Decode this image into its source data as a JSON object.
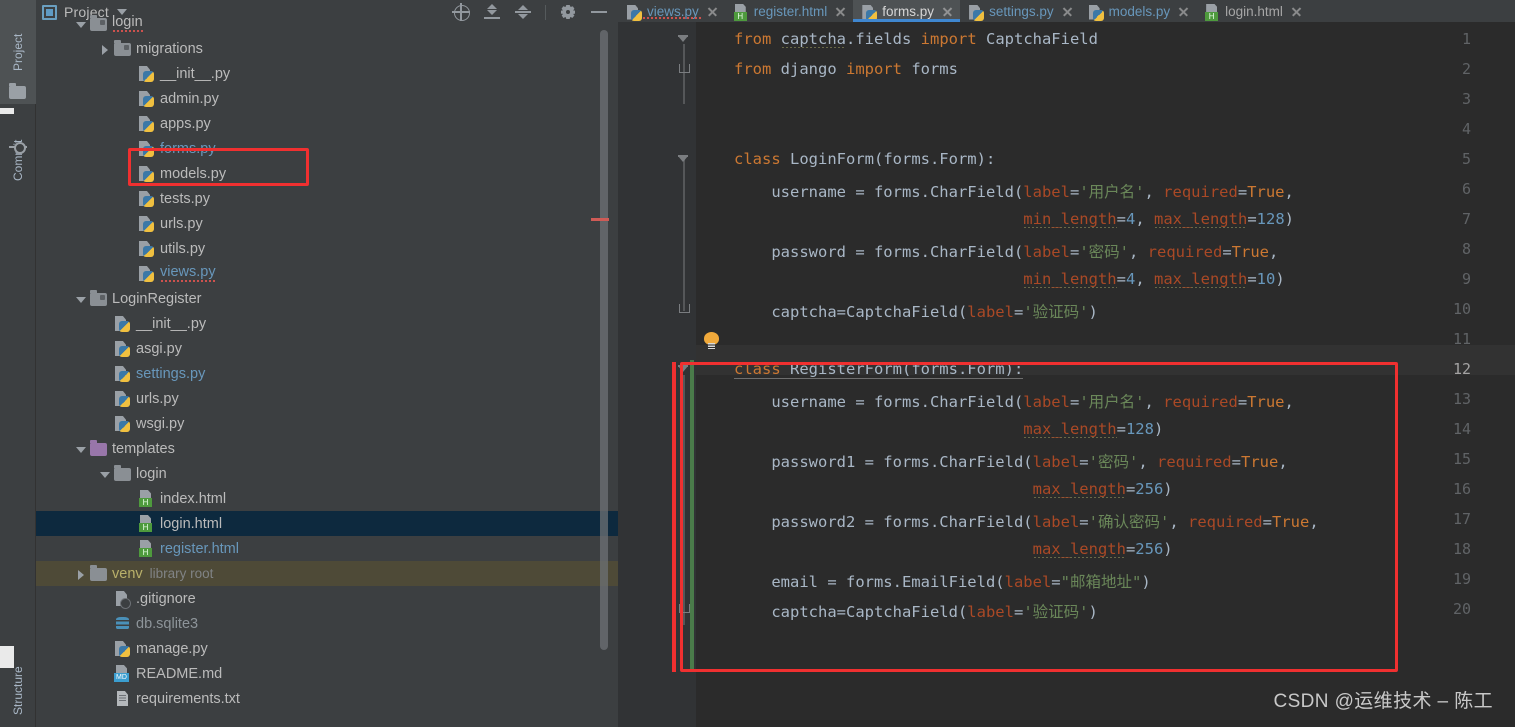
{
  "toolwindows": {
    "left_tabs": [
      {
        "label": "Project",
        "icon": "folder-icon",
        "active": true
      },
      {
        "label": "Commit",
        "icon": "commit-icon",
        "active": false
      },
      {
        "label": "Structure",
        "icon": "structure-icon",
        "active": false
      }
    ]
  },
  "project_panel": {
    "title": "Project",
    "title_icon": "project-view-icon",
    "dropdown_icon": "chevron-down-icon",
    "toolbar": [
      {
        "name": "select-opened-file-icon",
        "tooltip": "Select Opened File"
      },
      {
        "name": "expand-all-icon",
        "tooltip": "Expand All"
      },
      {
        "name": "collapse-all-icon",
        "tooltip": "Collapse All"
      },
      {
        "name": "settings-gear-icon",
        "tooltip": "Options"
      },
      {
        "name": "hide-icon",
        "tooltip": "Hide"
      }
    ],
    "tree": [
      {
        "label": "login",
        "indent": 1,
        "type": "module-folder",
        "arrow": "down",
        "style": "normal",
        "squiggle": true
      },
      {
        "label": "migrations",
        "indent": 2,
        "type": "module-folder",
        "arrow": "right",
        "style": "normal"
      },
      {
        "label": "__init__.py",
        "indent": 3,
        "type": "python",
        "arrow": "none",
        "style": "normal"
      },
      {
        "label": "admin.py",
        "indent": 3,
        "type": "python",
        "arrow": "none",
        "style": "normal"
      },
      {
        "label": "apps.py",
        "indent": 3,
        "type": "python",
        "arrow": "none",
        "style": "normal"
      },
      {
        "label": "forms.py",
        "indent": 3,
        "type": "python",
        "arrow": "none",
        "style": "blue",
        "annotated": true
      },
      {
        "label": "models.py",
        "indent": 3,
        "type": "python",
        "arrow": "none",
        "style": "normal"
      },
      {
        "label": "tests.py",
        "indent": 3,
        "type": "python",
        "arrow": "none",
        "style": "normal"
      },
      {
        "label": "urls.py",
        "indent": 3,
        "type": "python",
        "arrow": "none",
        "style": "normal"
      },
      {
        "label": "utils.py",
        "indent": 3,
        "type": "python",
        "arrow": "none",
        "style": "normal"
      },
      {
        "label": "views.py",
        "indent": 3,
        "type": "python",
        "arrow": "none",
        "style": "blue",
        "squiggle": true
      },
      {
        "label": "LoginRegister",
        "indent": 1,
        "type": "module-folder",
        "arrow": "down",
        "style": "normal"
      },
      {
        "label": "__init__.py",
        "indent": 2,
        "type": "python",
        "arrow": "none",
        "style": "normal"
      },
      {
        "label": "asgi.py",
        "indent": 2,
        "type": "python",
        "arrow": "none",
        "style": "normal"
      },
      {
        "label": "settings.py",
        "indent": 2,
        "type": "python",
        "arrow": "none",
        "style": "blue"
      },
      {
        "label": "urls.py",
        "indent": 2,
        "type": "python",
        "arrow": "none",
        "style": "normal"
      },
      {
        "label": "wsgi.py",
        "indent": 2,
        "type": "python",
        "arrow": "none",
        "style": "normal"
      },
      {
        "label": "templates",
        "indent": 1,
        "type": "template-folder",
        "arrow": "down",
        "style": "normal"
      },
      {
        "label": "login",
        "indent": 2,
        "type": "plain-folder",
        "arrow": "down",
        "style": "normal"
      },
      {
        "label": "index.html",
        "indent": 3,
        "type": "html",
        "arrow": "none",
        "style": "normal"
      },
      {
        "label": "login.html",
        "indent": 3,
        "type": "html",
        "arrow": "none",
        "style": "normal",
        "selected": true
      },
      {
        "label": "register.html",
        "indent": 3,
        "type": "html",
        "arrow": "none",
        "style": "blue"
      },
      {
        "label": "venv",
        "indent": 1,
        "type": "plain-folder",
        "arrow": "right",
        "style": "venv",
        "suffix": "library root"
      },
      {
        "label": ".gitignore",
        "indent": 2,
        "type": "gitignore",
        "arrow": "none",
        "style": "normal"
      },
      {
        "label": "db.sqlite3",
        "indent": 2,
        "type": "sqlite",
        "arrow": "none",
        "style": "dim"
      },
      {
        "label": "manage.py",
        "indent": 2,
        "type": "python",
        "arrow": "none",
        "style": "normal"
      },
      {
        "label": "README.md",
        "indent": 2,
        "type": "markdown",
        "arrow": "none",
        "style": "normal"
      },
      {
        "label": "requirements.txt",
        "indent": 2,
        "type": "text",
        "arrow": "none",
        "style": "normal"
      }
    ]
  },
  "editor": {
    "tabs": [
      {
        "label": "views.py",
        "type": "python",
        "active": false,
        "style": "blue",
        "error": true
      },
      {
        "label": "register.html",
        "type": "html",
        "active": false,
        "style": "blue"
      },
      {
        "label": "forms.py",
        "type": "python",
        "active": true,
        "style": "normal"
      },
      {
        "label": "settings.py",
        "type": "python",
        "active": false,
        "style": "blue"
      },
      {
        "label": "models.py",
        "type": "python",
        "active": false,
        "style": "blue"
      },
      {
        "label": "login.html",
        "type": "html",
        "active": false,
        "style": "normal"
      }
    ],
    "close_icon": "close-icon",
    "caret_line": 12,
    "intention_icon": "lightbulb-icon",
    "lines": [
      {
        "n": 1,
        "text": "from captcha.fields import CaptchaField"
      },
      {
        "n": 2,
        "text": "from django import forms"
      },
      {
        "n": 3,
        "text": ""
      },
      {
        "n": 4,
        "text": ""
      },
      {
        "n": 5,
        "text": "class LoginForm(forms.Form):"
      },
      {
        "n": 6,
        "text": "    username = forms.CharField(label='用户名', required=True,"
      },
      {
        "n": 7,
        "text": "                               min_length=4, max_length=128)"
      },
      {
        "n": 8,
        "text": "    password = forms.CharField(label='密码', required=True,"
      },
      {
        "n": 9,
        "text": "                               min_length=4, max_length=10)"
      },
      {
        "n": 10,
        "text": "    captcha=CaptchaField(label='验证码')"
      },
      {
        "n": 11,
        "text": ""
      },
      {
        "n": 12,
        "text": "class RegisterForm(forms.Form):"
      },
      {
        "n": 13,
        "text": "    username = forms.CharField(label='用户名', required=True,"
      },
      {
        "n": 14,
        "text": "                               max_length=128)"
      },
      {
        "n": 15,
        "text": "    password1 = forms.CharField(label='密码', required=True,"
      },
      {
        "n": 16,
        "text": "                                max_length=256)"
      },
      {
        "n": 17,
        "text": "    password2 = forms.CharField(label='确认密码', required=True,"
      },
      {
        "n": 18,
        "text": "                                max_length=256)"
      },
      {
        "n": 19,
        "text": "    email = forms.EmailField(label=\"邮箱地址\")"
      },
      {
        "n": 20,
        "text": "    captcha=CaptchaField(label='验证码')"
      }
    ]
  },
  "annotations": {
    "box_color": "#f03030",
    "forms_py_highlight": "forms.py",
    "register_form_highlight": "class RegisterForm block"
  },
  "watermark": {
    "text": "CSDN @运维技术 – 陈工"
  },
  "colors": {
    "editor_bg": "#2b2b2b",
    "panel_bg": "#3c3f41",
    "gutter_bg": "#313335",
    "selection_bg": "#0d293e",
    "venv_bg": "#4e4a37",
    "accent_blue": "#3f87d0",
    "string_green": "#6a8759",
    "keyword_orange": "#cc7832",
    "number_blue": "#6897bb",
    "kwarg_orange": "#aa4926",
    "text_fg": "#a9b7c6"
  }
}
